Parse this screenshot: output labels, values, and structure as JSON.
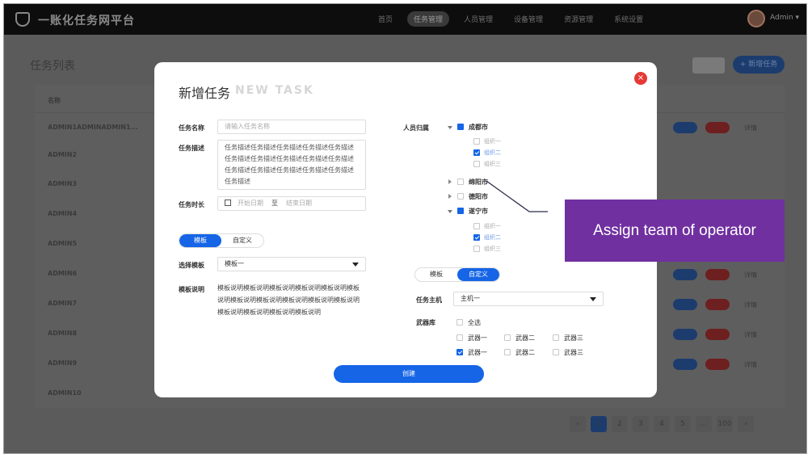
{
  "app": {
    "title": "一账化任务网平台",
    "nav": [
      "首页",
      "任务管理",
      "人员管理",
      "设备管理",
      "资源管理",
      "系统设置"
    ],
    "active_nav_index": 1,
    "user": "Admin ▾"
  },
  "background": {
    "page_title": "任务列表",
    "add_button": "+ 新增任务",
    "column_header": "名称",
    "rows": [
      "ADMIN1ADMINADMIN1...",
      "ADMIN2",
      "ADMIN3",
      "ADMIN4",
      "ADMIN5",
      "ADMIN6",
      "ADMIN7",
      "ADMIN8",
      "ADMIN9",
      "ADMIN10"
    ],
    "row_action": "详情",
    "pager": [
      "‹",
      "1",
      "2",
      "3",
      "4",
      "5",
      "…",
      "100",
      "›"
    ]
  },
  "modal": {
    "title": "新增任务",
    "title_en": "NEW TASK",
    "task_name_label": "任务名称",
    "task_name_placeholder": "请输入任务名称",
    "task_desc_label": "任务描述",
    "task_desc_value": "任务描述任务描述任务描述任务描述任务描述任务描述任务描述任务描述任务描述任务描述任务描述任务描述任务描述任务描述任务描述任务描述",
    "task_time_label": "任务时长",
    "start_date": "开始日期",
    "date_sep": "至",
    "end_date": "结束日期",
    "mode_left": {
      "template": "模板",
      "custom": "自定义",
      "selected": "template"
    },
    "template_label": "选择模板",
    "template_value": "模板一",
    "template_desc_label": "模板说明",
    "template_desc": "模板说明模板说明模板说明模板说明模板说明模板说明模板说明模板说明模板说明模板说明模板说明模板说明模板说明模板说明模板说明",
    "personnel_label": "人员归属",
    "tree": [
      {
        "name": "成都市",
        "expanded": true,
        "children": [
          {
            "name": "组织一",
            "checked": false
          },
          {
            "name": "组织二",
            "checked": true
          },
          {
            "name": "组织三",
            "checked": false
          }
        ]
      },
      {
        "name": "绵阳市",
        "expanded": false,
        "children": []
      },
      {
        "name": "德阳市",
        "expanded": false,
        "children": []
      },
      {
        "name": "遂宁市",
        "expanded": true,
        "children": [
          {
            "name": "组织一",
            "checked": false
          },
          {
            "name": "组织二",
            "checked": true
          },
          {
            "name": "组织三",
            "checked": false
          }
        ]
      }
    ],
    "mode_right": {
      "template": "模板",
      "custom": "自定义",
      "selected": "custom"
    },
    "host_label": "任务主机",
    "host_value": "主机一",
    "weapons_label": "武器库",
    "select_all": "全选",
    "weapons_row1": [
      "武器一",
      "武器二",
      "武器三"
    ],
    "weapons_row2": [
      "武器一",
      "武器二",
      "武器三"
    ],
    "create_button": "创建",
    "close_icon": "×"
  },
  "annotation": {
    "text": "Assign team of operator",
    "color": "#7030a0"
  }
}
